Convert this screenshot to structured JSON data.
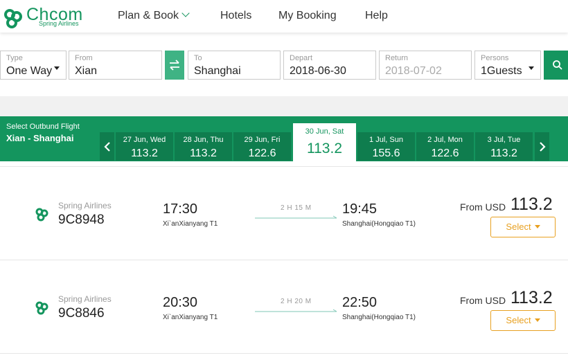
{
  "brand": {
    "name": "Chcom",
    "sub": "Spring Airlines",
    "color": "#14955e"
  },
  "nav": {
    "items": [
      {
        "label": "Plan & Book",
        "has_dropdown": true
      },
      {
        "label": "Hotels"
      },
      {
        "label": "My Booking"
      },
      {
        "label": "Help"
      }
    ]
  },
  "search": {
    "type": {
      "label": "Type",
      "value": "One Way"
    },
    "from": {
      "label": "From",
      "value": "Xian"
    },
    "to": {
      "label": "To",
      "value": "Shanghai"
    },
    "depart": {
      "label": "Depart",
      "value": "2018-06-30"
    },
    "return": {
      "label": "Return",
      "value": "2018-07-02"
    },
    "persons": {
      "label": "Persons",
      "value": "1Guests"
    },
    "swap_icon": "swap-arrows-icon",
    "search_icon": "search-icon"
  },
  "outbound": {
    "title": "Select Outbund Flight",
    "route": "Xian - Shanghai",
    "dates": [
      {
        "date": "27 Jun, Wed",
        "price": "113.2"
      },
      {
        "date": "28 Jun, Thu",
        "price": "113.2"
      },
      {
        "date": "29 Jun, Fri",
        "price": "122.6"
      },
      {
        "date": "30 Jun, Sat",
        "price": "113.2",
        "selected": true
      },
      {
        "date": "1 Jul, Sun",
        "price": "155.6"
      },
      {
        "date": "2 Jul, Mon",
        "price": "122.6"
      },
      {
        "date": "3 Jul, Tue",
        "price": "113.2"
      }
    ]
  },
  "flights": [
    {
      "airline": "Spring Airlines",
      "flight_no": "9C8948",
      "dep_time": "17:30",
      "dep_airport": "Xi`anXianyang T1",
      "duration": "2 H 15 M",
      "arr_time": "19:45",
      "arr_airport": "Shanghai(Hongqiao T1)",
      "from_label": "From USD",
      "price": "113.2",
      "select_label": "Select"
    },
    {
      "airline": "Spring Airlines",
      "flight_no": "9C8846",
      "dep_time": "20:30",
      "dep_airport": "Xi`anXianyang T1",
      "duration": "2 H 20 M",
      "arr_time": "22:50",
      "arr_airport": "Shanghai(Hongqiao T1)",
      "from_label": "From USD",
      "price": "113.2",
      "select_label": "Select"
    }
  ]
}
